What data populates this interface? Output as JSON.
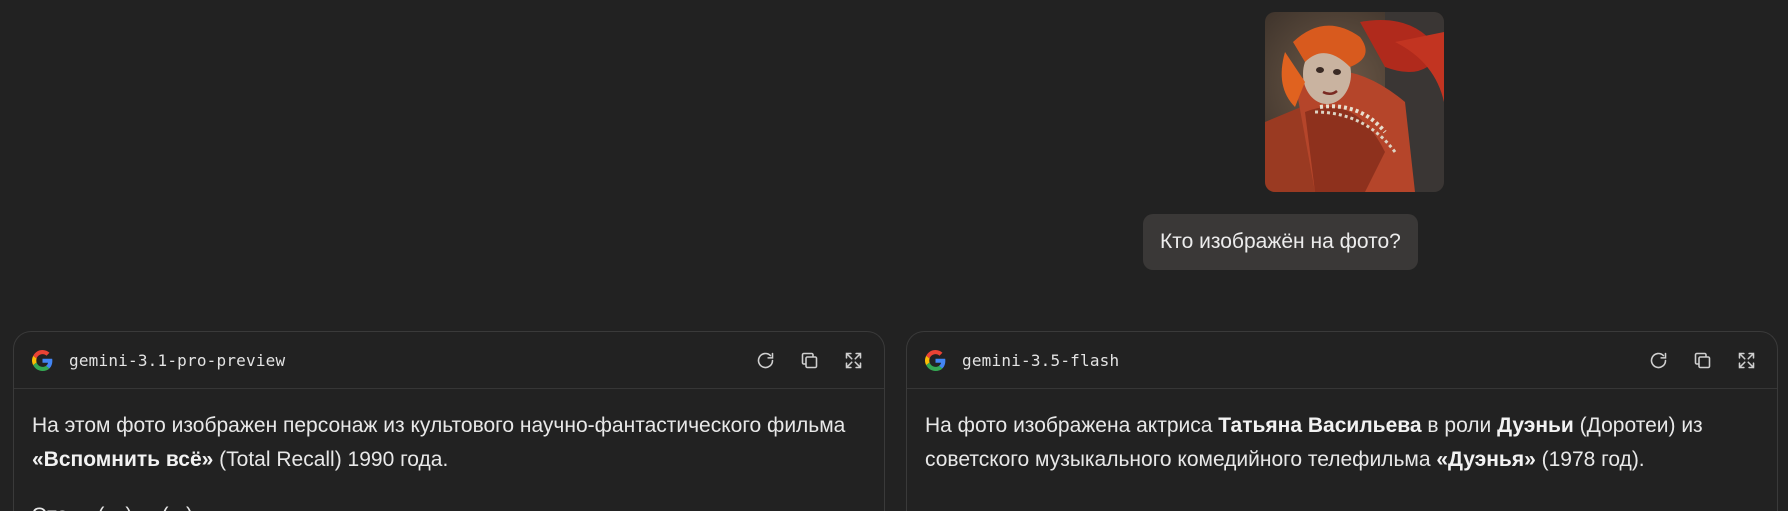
{
  "conversation": {
    "user_message": {
      "image_icon": "photo-thumbnail",
      "text": "Кто изображён на фото?"
    }
  },
  "panels": [
    {
      "model": "gemini-3.1-pro-preview",
      "logo_icon": "google-g-icon",
      "tools": [
        "refresh-icon",
        "copy-icon",
        "expand-icon"
      ],
      "paragraphs": [
        [
          {
            "t": "На этом фото изображен персонаж из культового научно-фантастического фильма ",
            "b": false
          },
          {
            "t": "«Вспомнить всё»",
            "b": true
          },
          {
            "t": " (Total Recall) 1990 года.",
            "b": false
          }
        ],
        [
          {
            "t": "Это ... (—) ... (...).",
            "b": false
          }
        ]
      ]
    },
    {
      "model": "gemini-3.5-flash",
      "logo_icon": "google-g-icon",
      "tools": [
        "refresh-icon",
        "copy-icon",
        "expand-icon"
      ],
      "paragraphs": [
        [
          {
            "t": "На фото изображена актриса ",
            "b": false
          },
          {
            "t": "Татьяна Васильева",
            "b": true
          },
          {
            "t": " в роли ",
            "b": false
          },
          {
            "t": "Дуэньи",
            "b": true
          },
          {
            "t": " (Доротеи) из советского музыкального комедийного телефильма ",
            "b": false
          },
          {
            "t": "«Дуэнья»",
            "b": true
          },
          {
            "t": " (1978 год).",
            "b": false
          }
        ]
      ]
    }
  ],
  "colors": {
    "background": "#222222",
    "bubble": "#3a3837",
    "panel_border": "#3a3a3a",
    "text": "#e8e8e8"
  }
}
